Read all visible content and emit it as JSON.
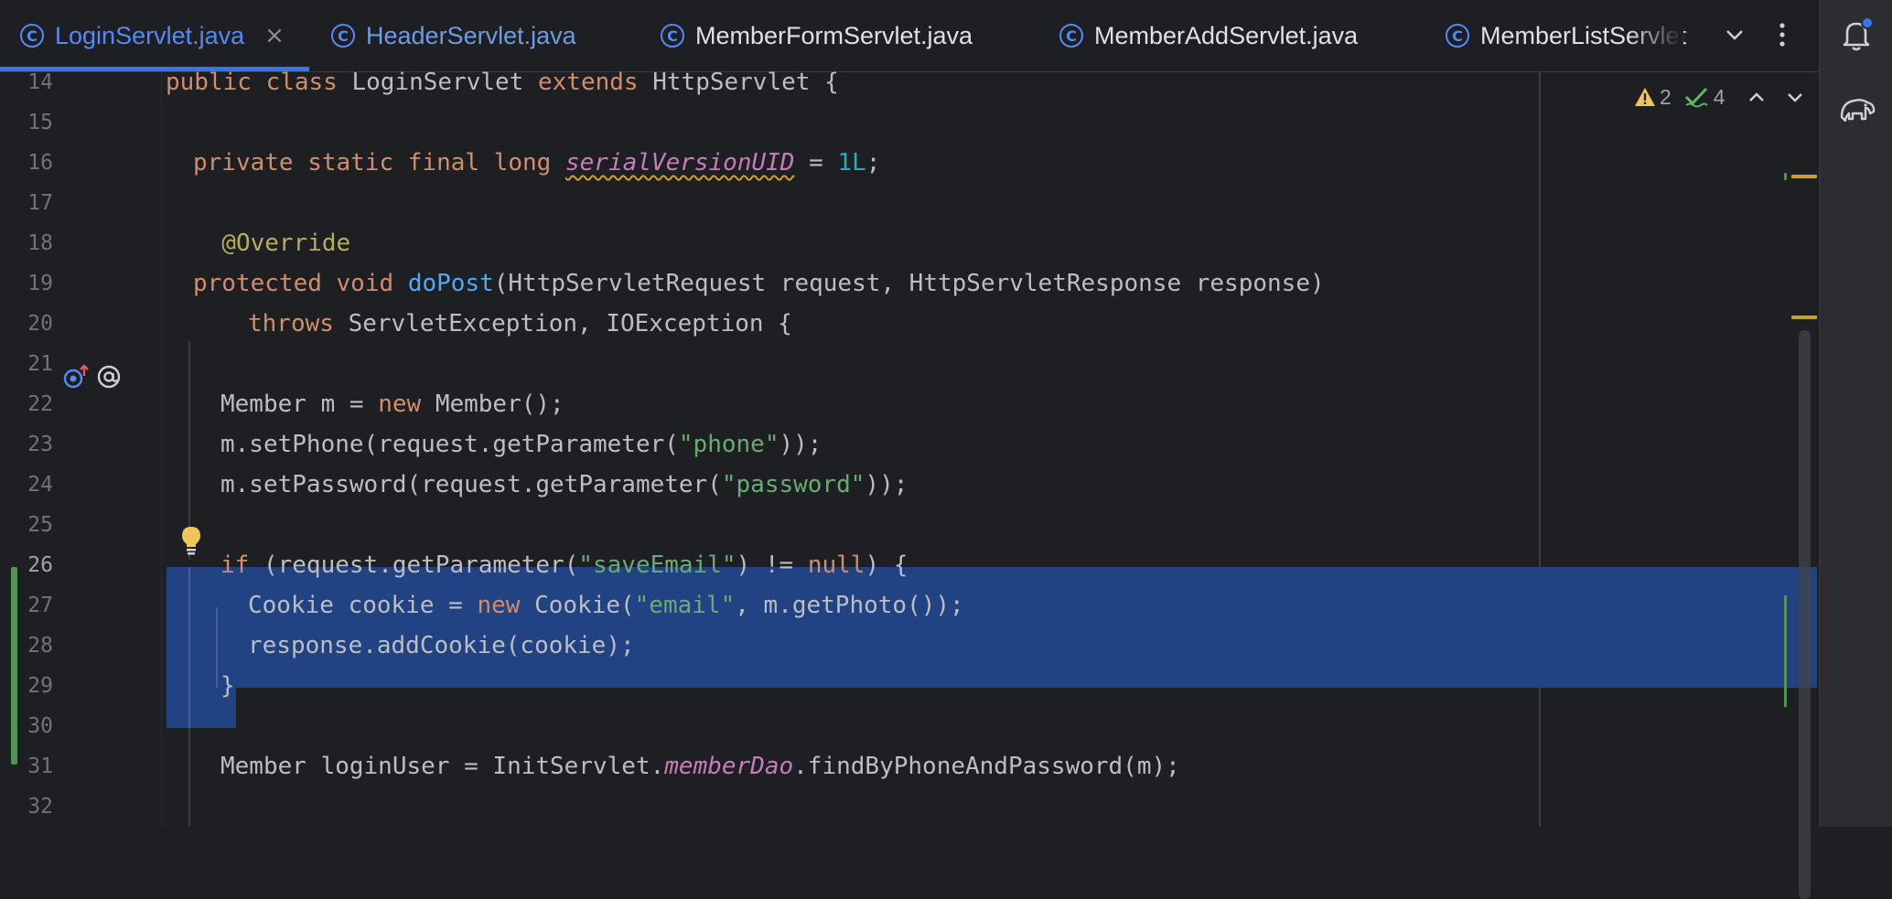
{
  "tabs": [
    {
      "label": "LoginServlet.java",
      "active": true,
      "close": "×",
      "icon": "class-icon"
    },
    {
      "label": "HeaderServlet.java",
      "active": false,
      "icon": "class-icon"
    },
    {
      "label": "MemberFormServlet.java",
      "active": false,
      "icon": "class-icon"
    },
    {
      "label": "MemberAddServlet.java",
      "active": false,
      "icon": "class-icon"
    },
    {
      "label": "MemberListServlet",
      "active": false,
      "icon": "class-icon"
    }
  ],
  "toolbar": {
    "tab_list_icon": "chevron-down-icon",
    "more_icon": "more-vertical-icon"
  },
  "toolstrip": {
    "notifications_icon": "bell-icon",
    "assistant_icon": "elephant-icon"
  },
  "inspections": {
    "warnings": "2",
    "weak_warnings": "4"
  },
  "lines": [
    {
      "num": "14",
      "code": "public class LoginServlet extends HttpServlet {"
    },
    {
      "num": "15",
      "code": ""
    },
    {
      "num": "16",
      "code": "  private static final long serialVersionUID = 1L;"
    },
    {
      "num": "17",
      "code": ""
    },
    {
      "num": "18",
      "code": "  @Override"
    },
    {
      "num": "19",
      "code": "  protected void doPost(HttpServletRequest request, HttpServletResponse response)"
    },
    {
      "num": "20",
      "code": "      throws ServletException, IOException {"
    },
    {
      "num": "21",
      "code": ""
    },
    {
      "num": "22",
      "code": "    Member m = new Member();"
    },
    {
      "num": "23",
      "code": "    m.setPhone(request.getParameter(\"phone\"));"
    },
    {
      "num": "24",
      "code": "    m.setPassword(request.getParameter(\"password\"));"
    },
    {
      "num": "25",
      "code": ""
    },
    {
      "num": "26",
      "code": "    if (request.getParameter(\"saveEmail\") != null) {"
    },
    {
      "num": "27",
      "code": "      Cookie cookie = new Cookie(\"email\", m.getPhoto());"
    },
    {
      "num": "28",
      "code": "      response.addCookie(cookie);"
    },
    {
      "num": "29",
      "code": "    }"
    },
    {
      "num": "30",
      "code": ""
    },
    {
      "num": "31",
      "code": "    Member loginUser = InitServlet.memberDao.findByPhoneAndPassword(m);"
    },
    {
      "num": "32",
      "code": ""
    }
  ],
  "colors": {
    "keyword": "#cf8e6d",
    "method": "#56a8f5",
    "string": "#6aab73",
    "number": "#2aacb8",
    "annotation": "#b3ae60",
    "static_field": "#c77dbb",
    "selection": "#214283",
    "accent": "#3574f0"
  }
}
